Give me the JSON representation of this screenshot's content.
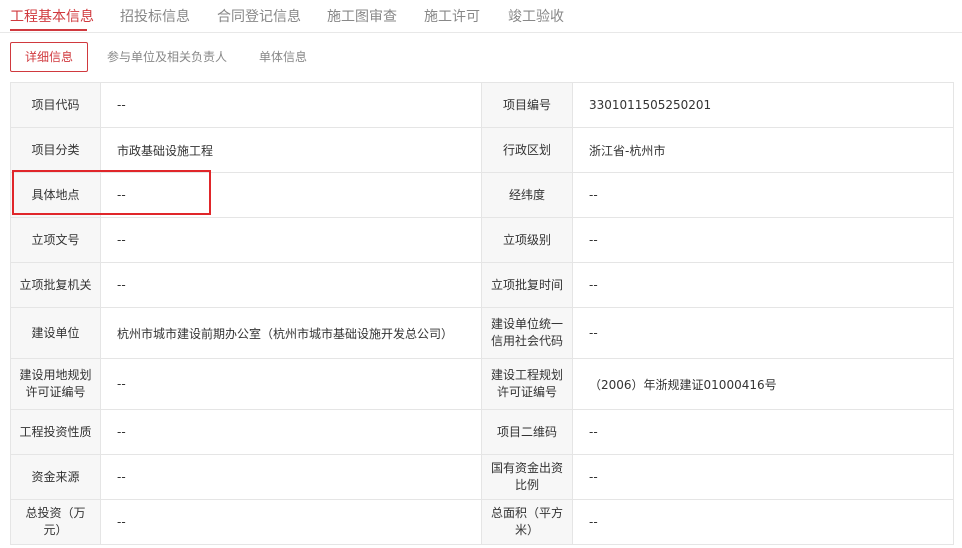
{
  "tabs": [
    {
      "label": "工程基本信息"
    },
    {
      "label": "招投标信息"
    },
    {
      "label": "合同登记信息"
    },
    {
      "label": "施工图审查"
    },
    {
      "label": "施工许可"
    },
    {
      "label": "竣工验收"
    }
  ],
  "subtabs": [
    {
      "label": "详细信息"
    },
    {
      "label": "参与单位及相关负责人"
    },
    {
      "label": "单体信息"
    }
  ],
  "colors": {
    "accent": "#d0393e",
    "highlight": "#e0262a",
    "label_bg": "#f7f7f7"
  },
  "rows": [
    {
      "l1": "项目代码",
      "v1": "--",
      "l2": "项目编号",
      "v2": "3301011505250201"
    },
    {
      "l1": "项目分类",
      "v1": "市政基础设施工程",
      "l2": "行政区划",
      "v2": "浙江省-杭州市"
    },
    {
      "l1": "具体地点",
      "v1": "--",
      "l2": "经纬度",
      "v2": "--"
    },
    {
      "l1": "立项文号",
      "v1": "--",
      "l2": "立项级别",
      "v2": "--"
    },
    {
      "l1": "立项批复机关",
      "v1": "--",
      "l2": "立项批复时间",
      "v2": "--"
    },
    {
      "l1": "建设单位",
      "v1": "杭州市城市建设前期办公室（杭州市城市基础设施开发总公司）",
      "l2": "建设单位统一信用社会代码",
      "v2": "--"
    },
    {
      "l1": "建设用地规划许可证编号",
      "v1": "--",
      "l2": "建设工程规划许可证编号",
      "v2": "（2006）年浙规建证01000416号"
    },
    {
      "l1": "工程投资性质",
      "v1": "--",
      "l2": "项目二维码",
      "v2": "--"
    },
    {
      "l1": "资金来源",
      "v1": "--",
      "l2": "国有资金出资比例",
      "v2": "--"
    },
    {
      "l1": "总投资（万元）",
      "v1": "--",
      "l2": "总面积（平方米）",
      "v2": "--"
    }
  ]
}
